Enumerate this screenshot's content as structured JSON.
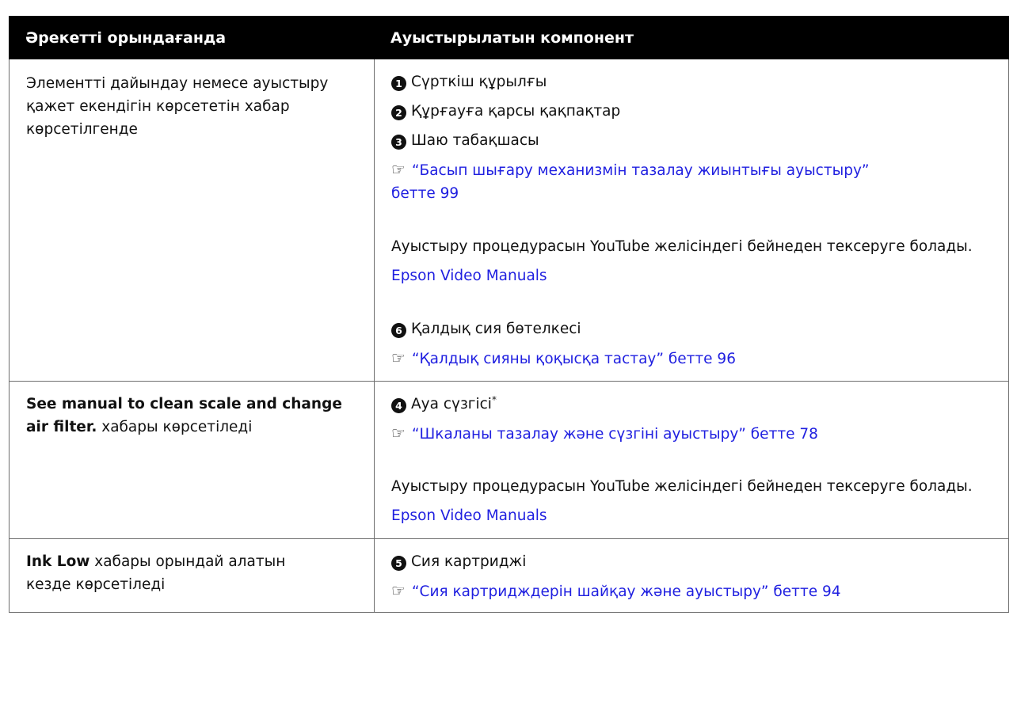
{
  "table": {
    "headers": [
      "Әрекетті орындағанда",
      "Ауыстырылатын компонент"
    ],
    "rows": [
      {
        "condition": {
          "text": "Элементті дайындау немесе ауыстыру қажет екендігін көрсететін хабар көрсетілгенде"
        },
        "items": [
          {
            "num": "1",
            "label": "Сүрткіш құрылғы"
          },
          {
            "num": "2",
            "label": "Құрғауға қарсы қақпақтар"
          },
          {
            "num": "3",
            "label": "Шаю табақшасы"
          }
        ],
        "ref1": {
          "icon": "pointing-hand-icon",
          "line1": "“Басып шығару механизмін тазалау жиынтығы ауыстыру”",
          "line2": "бетте 99"
        },
        "note": "Ауыстыру процедурасын YouTube желісіндегі бейнеден тексеруге болады.",
        "video_link": "Epson Video Manuals",
        "item2": {
          "num": "6",
          "label": "Қалдық сия бөтелкесі"
        },
        "ref2": {
          "icon": "pointing-hand-icon",
          "text": "“Қалдық сияны қоқысқа тастау” бетте 96"
        }
      },
      {
        "condition": {
          "bold": "See manual to clean scale and change air filter.",
          "text": " хабары көрсетіледі"
        },
        "item": {
          "num": "4",
          "label": "Ауа сүзгісі",
          "sup": "*"
        },
        "ref": {
          "icon": "pointing-hand-icon",
          "text": "“Шкаланы тазалау және сүзгіні ауыстыру” бетте 78"
        },
        "note": "Ауыстыру процедурасын YouTube желісіндегі бейнеден тексеруге болады.",
        "video_link": "Epson Video Manuals"
      },
      {
        "condition": {
          "bold": "Ink Low",
          "text": " хабары орындай алатын кезде көрсетіледі"
        },
        "item": {
          "num": "5",
          "label": "Сия картриджі"
        },
        "ref": {
          "icon": "pointing-hand-icon",
          "text": "“Сия картридждерін шайқау және ауыстыру” бетте 94"
        }
      }
    ]
  }
}
